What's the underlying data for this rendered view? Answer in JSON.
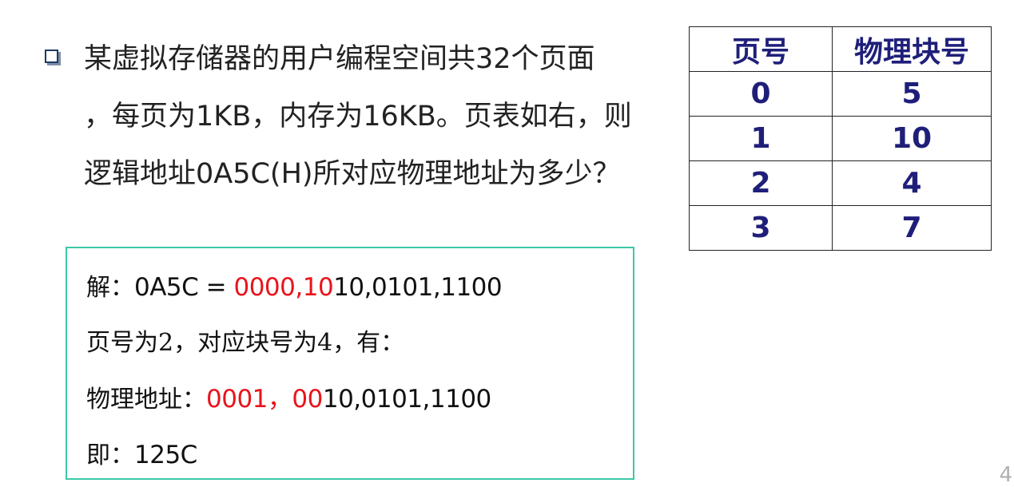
{
  "question": {
    "lines": [
      "某虚拟存储器的用户编程空间共32个页面",
      "，每页为1KB，内存为16KB。页表如右，则",
      "逻辑地址0A5C(H)所对应物理地址为多少？"
    ]
  },
  "page_table": {
    "headers": [
      "页号",
      "物理块号"
    ],
    "rows": [
      [
        "0",
        "5"
      ],
      [
        "1",
        "10"
      ],
      [
        "2",
        "4"
      ],
      [
        "3",
        "7"
      ]
    ]
  },
  "solution": {
    "line1_label": "解：",
    "line1_prefix": "0A5C = ",
    "line1_red": "0000,10",
    "line1_rest": "10,0101,1100",
    "line2": "页号为2，对应块号为4，有：",
    "line3_label": "物理地址：",
    "line3_red": "0001，00",
    "line3_rest": "10,0101,1100",
    "line4_label": "即：",
    "line4_value": "125C"
  },
  "page_number": "4",
  "colors": {
    "accent_red": "#e8141b",
    "box_border": "#3cc8a8",
    "table_text": "#1f1f7a"
  }
}
